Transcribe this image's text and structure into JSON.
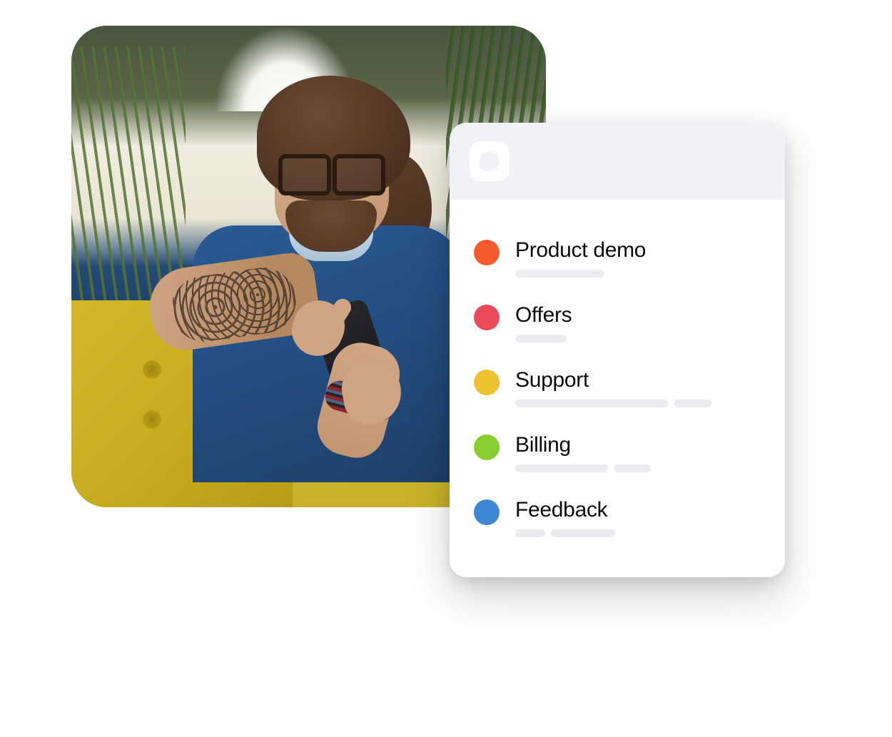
{
  "menu": {
    "items": [
      {
        "label": "Product demo",
        "dot_color": "#f55a2e",
        "icon_name": "product-demo-dot",
        "placeholders": [
          125
        ]
      },
      {
        "label": "Offers",
        "dot_color": "#ea4a59",
        "icon_name": "offers-dot",
        "placeholders": [
          72
        ]
      },
      {
        "label": "Support",
        "dot_color": "#efc12f",
        "icon_name": "support-dot",
        "placeholders": [
          215,
          52
        ]
      },
      {
        "label": "Billing",
        "dot_color": "#89ce2f",
        "icon_name": "billing-dot",
        "placeholders": [
          130,
          52
        ]
      },
      {
        "label": "Feedback",
        "dot_color": "#3f86d6",
        "icon_name": "feedback-dot",
        "placeholders": [
          42,
          90
        ]
      }
    ]
  }
}
